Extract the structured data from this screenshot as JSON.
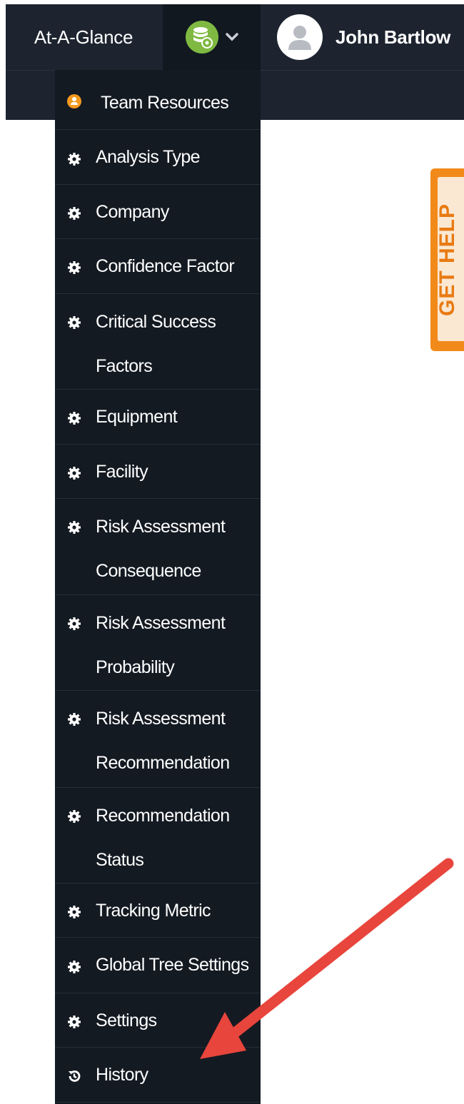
{
  "nav": {
    "at_a_glance": "At-A-Glance",
    "user_name": "John Bartlow"
  },
  "help": {
    "label": "GET HELP"
  },
  "menu": {
    "items": [
      {
        "label": "Team Resources",
        "icon": "team-resources-icon"
      },
      {
        "label": "Analysis Type",
        "icon": "gear-icon"
      },
      {
        "label": "Company",
        "icon": "gear-icon"
      },
      {
        "label": "Confidence Factor",
        "icon": "gear-icon"
      },
      {
        "label": "Critical Success",
        "label2": "Factors",
        "icon": "gear-icon"
      },
      {
        "label": "Equipment",
        "icon": "gear-icon"
      },
      {
        "label": "Facility",
        "icon": "gear-icon"
      },
      {
        "label": "Risk Assessment",
        "label2": "Consequence",
        "icon": "gear-icon"
      },
      {
        "label": "Risk Assessment",
        "label2": "Probability",
        "icon": "gear-icon"
      },
      {
        "label": "Risk Assessment",
        "label2": "Recommendation",
        "icon": "gear-icon"
      },
      {
        "label": "Recommendation",
        "label2": "Status",
        "icon": "gear-icon"
      },
      {
        "label": "Tracking Metric",
        "icon": "gear-icon"
      },
      {
        "label": "Global Tree Settings",
        "icon": "gear-icon"
      },
      {
        "label": "Settings",
        "icon": "gear-icon"
      },
      {
        "label": "History",
        "icon": "history-icon"
      }
    ]
  },
  "colors": {
    "nav_bg": "#1d2430",
    "menu_bg": "#141a22",
    "accent_green": "#7fb942",
    "help_orange": "#f28a1a",
    "arrow_red": "#e8453c"
  }
}
